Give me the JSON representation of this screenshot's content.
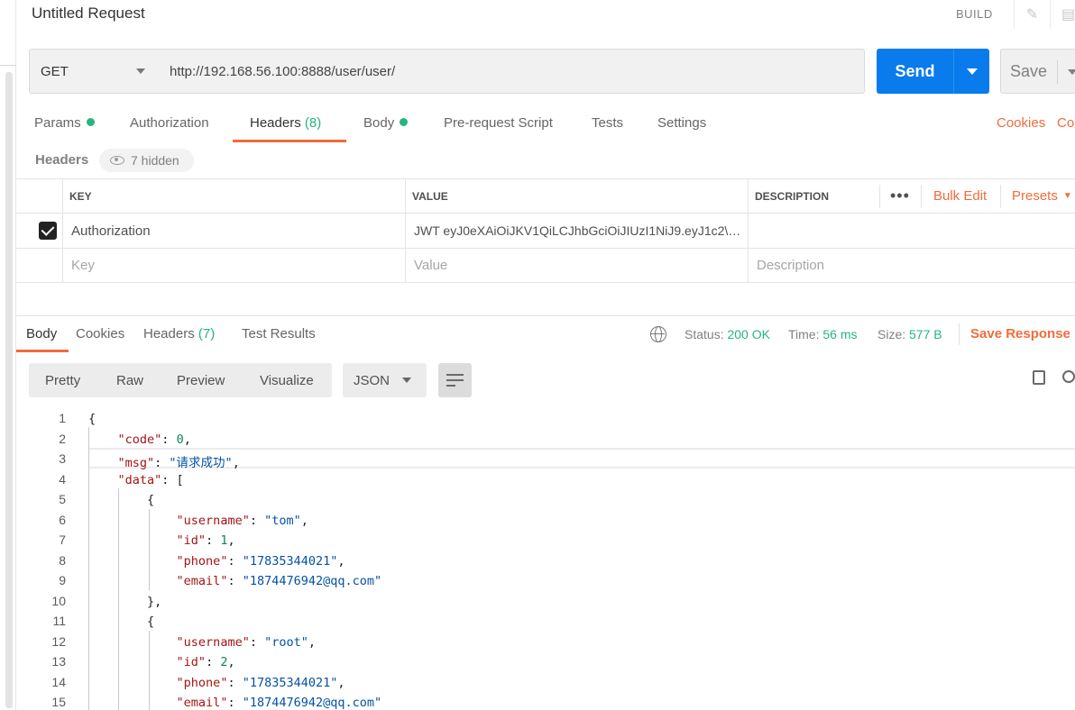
{
  "request": {
    "title": "Untitled Request",
    "build_label": "BUILD",
    "method": "GET",
    "url": "http://192.168.56.100:8888/user/user/",
    "send_label": "Send",
    "save_label": "Save"
  },
  "request_tabs": [
    {
      "label": "Params",
      "dot": true
    },
    {
      "label": "Authorization",
      "dot": false
    },
    {
      "label": "Headers",
      "count": "(8)",
      "active": true
    },
    {
      "label": "Body",
      "dot": true
    },
    {
      "label": "Pre-request Script",
      "dot": false
    },
    {
      "label": "Tests",
      "dot": false
    },
    {
      "label": "Settings",
      "dot": false
    }
  ],
  "links": {
    "cookies": "Cookies",
    "code": "Co"
  },
  "headers_section": {
    "label": "Headers",
    "hidden_label": "7 hidden",
    "columns": {
      "key": "KEY",
      "value": "VALUE",
      "description": "DESCRIPTION"
    },
    "more": "•••",
    "bulk_edit": "Bulk Edit",
    "presets": "Presets",
    "rows": [
      {
        "checked": true,
        "key": "Authorization",
        "value": "JWT eyJ0eXAiOiJKV1QiLCJhbGciOiJIUzI1NiJ9.eyJ1c2\\…",
        "description": ""
      }
    ],
    "placeholders": {
      "key": "Key",
      "value": "Value",
      "description": "Description"
    }
  },
  "response": {
    "tabs": [
      {
        "label": "Body",
        "active": true
      },
      {
        "label": "Cookies"
      },
      {
        "label": "Headers",
        "count": "(7)"
      },
      {
        "label": "Test Results"
      }
    ],
    "status_label": "Status:",
    "status_value": "200 OK",
    "time_label": "Time:",
    "time_value": "56 ms",
    "size_label": "Size:",
    "size_value": "577 B",
    "save_response": "Save Response",
    "view_modes": [
      "Pretty",
      "Raw",
      "Preview",
      "Visualize"
    ],
    "format": "JSON"
  },
  "body_lines": [
    {
      "n": "1",
      "t": "{"
    },
    {
      "n": "2",
      "t": "    \"code\": 0,"
    },
    {
      "n": "3",
      "t": "    \"msg\": \"请求成功\","
    },
    {
      "n": "4",
      "t": "    \"data\": ["
    },
    {
      "n": "5",
      "t": "        {"
    },
    {
      "n": "6",
      "t": "            \"username\": \"tom\","
    },
    {
      "n": "7",
      "t": "            \"id\": 1,"
    },
    {
      "n": "8",
      "t": "            \"phone\": \"17835344021\","
    },
    {
      "n": "9",
      "t": "            \"email\": \"1874476942@qq.com\""
    },
    {
      "n": "10",
      "t": "        },"
    },
    {
      "n": "11",
      "t": "        {"
    },
    {
      "n": "12",
      "t": "            \"username\": \"root\","
    },
    {
      "n": "13",
      "t": "            \"id\": 2,"
    },
    {
      "n": "14",
      "t": "            \"phone\": \"17835344021\","
    },
    {
      "n": "15",
      "t": "            \"email\": \"1874476942@qq.com\""
    }
  ],
  "colors": {
    "accent": "#f26b3a",
    "send": "#097bed",
    "success": "#26b47f"
  }
}
